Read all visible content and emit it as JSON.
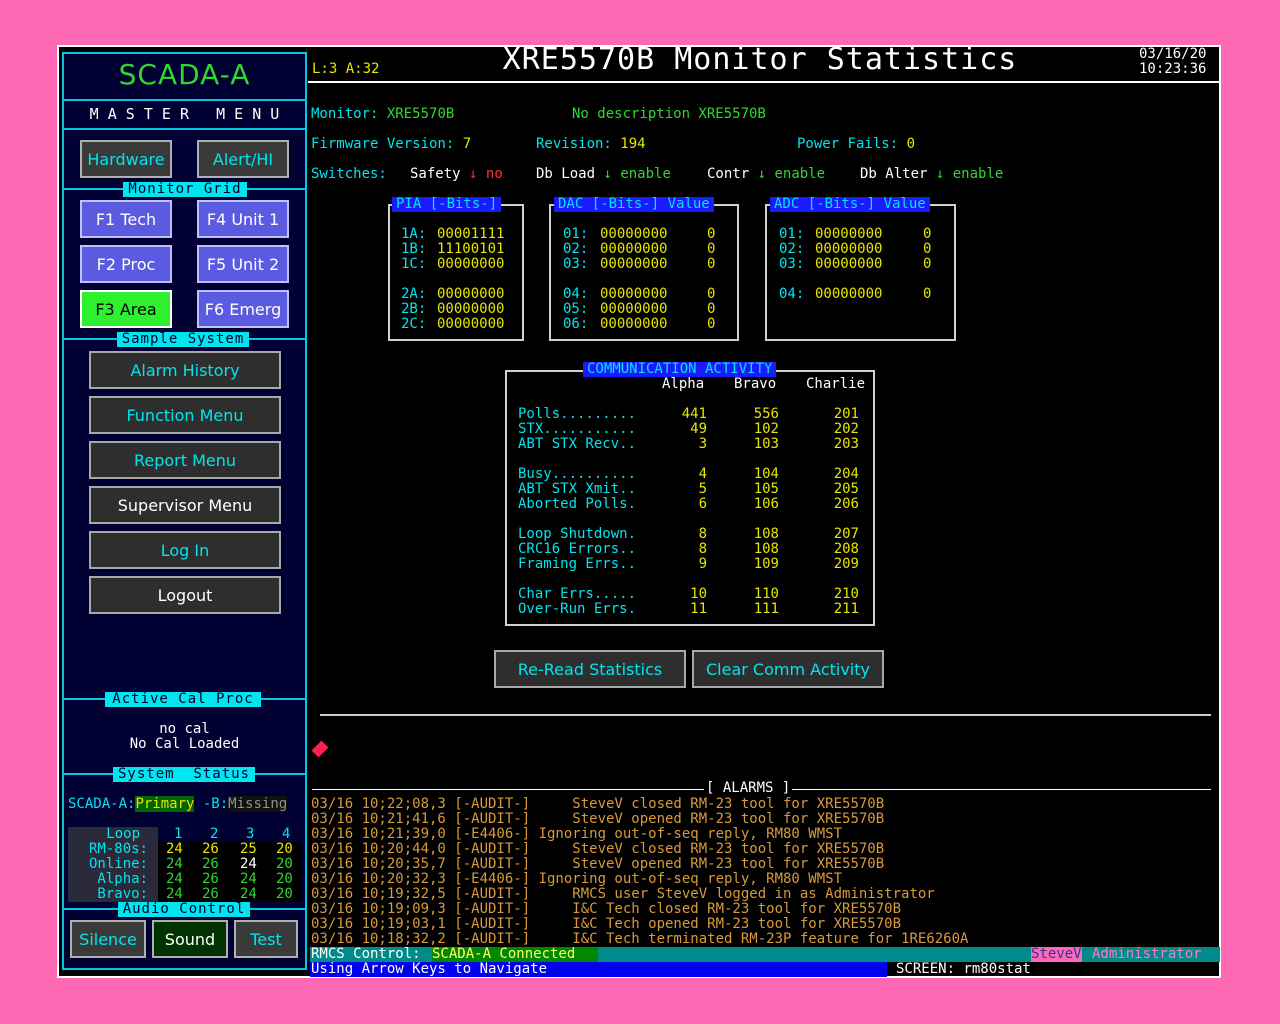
{
  "sidebar": {
    "title": "SCADA-A",
    "master_menu": "M A S T E R   M E N U",
    "hardware_btn": "Hardware",
    "alert_btn": "Alert/HI",
    "monitor_grid_title": "Monitor Grid",
    "grid_buttons": [
      "F1 Tech",
      "F4 Unit 1",
      "F2 Proc",
      "F5 Unit 2",
      "F3 Area",
      "F6 Emerg"
    ],
    "sample_system_title": "Sample System",
    "menu_buttons": [
      "Alarm History",
      "Function Menu",
      "Report Menu",
      "Supervisor Menu",
      "Log In",
      "Logout"
    ],
    "active_cal_title": "Active Cal Proc",
    "cal_line1": "no cal",
    "cal_line2": "No Cal Loaded",
    "system_status_title": "System  Status",
    "status_a_label": "SCADA-A:",
    "status_a_value": "Primary",
    "status_b_label": " -B:",
    "status_b_value": "Missing",
    "loop_table": {
      "header": [
        "Loop",
        "1",
        "2",
        "3",
        "4"
      ],
      "rows": [
        {
          "label": "RM-80s:",
          "values": [
            "24",
            "26",
            "25",
            "20"
          ]
        },
        {
          "label": "Online:",
          "values": [
            "24",
            "26",
            "24",
            "20"
          ]
        },
        {
          "label": "Alpha:",
          "values": [
            "24",
            "26",
            "24",
            "20"
          ]
        },
        {
          "label": "Bravo:",
          "values": [
            "24",
            "26",
            "24",
            "20"
          ]
        }
      ]
    },
    "audio_title": "Audio Control",
    "audio_buttons": [
      "Silence",
      "Sound",
      "Test"
    ]
  },
  "header": {
    "la": "L:3 A:32",
    "title": "XRE5570B Monitor Statistics",
    "date": "03/16/20",
    "time": "10:23:36"
  },
  "monitor": {
    "monitor_label": "Monitor:",
    "monitor_value": "XRE5570B",
    "description": "No description XRE5570B",
    "fw_label": "Firmware Version:",
    "fw_value": "7",
    "rev_label": "Revision:",
    "rev_value": "194",
    "pf_label": "Power Fails:",
    "pf_value": "0",
    "switches_label": "Switches:",
    "switches": [
      {
        "name": "Safety",
        "value": "no"
      },
      {
        "name": "Db Load",
        "value": "enable"
      },
      {
        "name": "Contr",
        "value": "enable"
      },
      {
        "name": "Db Alter",
        "value": "enable"
      }
    ]
  },
  "pia": {
    "title": "PIA [-Bits-]",
    "group1": [
      [
        "1A:",
        "00001111"
      ],
      [
        "1B:",
        "11100101"
      ],
      [
        "1C:",
        "00000000"
      ]
    ],
    "group2": [
      [
        "2A:",
        "00000000"
      ],
      [
        "2B:",
        "00000000"
      ],
      [
        "2C:",
        "00000000"
      ]
    ]
  },
  "dac": {
    "title": "DAC [-Bits-] Value",
    "group1": [
      [
        "01:",
        "00000000",
        "0"
      ],
      [
        "02:",
        "00000000",
        "0"
      ],
      [
        "03:",
        "00000000",
        "0"
      ]
    ],
    "group2": [
      [
        "04:",
        "00000000",
        "0"
      ],
      [
        "05:",
        "00000000",
        "0"
      ],
      [
        "06:",
        "00000000",
        "0"
      ]
    ]
  },
  "adc": {
    "title": "ADC [-Bits-] Value",
    "group1": [
      [
        "01:",
        "00000000",
        "0"
      ],
      [
        "02:",
        "00000000",
        "0"
      ],
      [
        "03:",
        "00000000",
        "0"
      ]
    ],
    "group2": [
      [
        "04:",
        "00000000",
        "0"
      ]
    ]
  },
  "comm": {
    "title": "COMMUNICATION ACTIVITY",
    "columns": [
      "Alpha",
      "Bravo",
      "Charlie"
    ],
    "groups": [
      [
        [
          "Polls.........",
          "441",
          "556",
          "201"
        ],
        [
          "STX...........",
          "49",
          "102",
          "202"
        ],
        [
          "ABT STX Recv..",
          "3",
          "103",
          "203"
        ]
      ],
      [
        [
          "Busy..........",
          "4",
          "104",
          "204"
        ],
        [
          "ABT STX Xmit..",
          "5",
          "105",
          "205"
        ],
        [
          "Aborted Polls.",
          "6",
          "106",
          "206"
        ]
      ],
      [
        [
          "Loop Shutdown.",
          "8",
          "108",
          "207"
        ],
        [
          "CRC16 Errors..",
          "8",
          "108",
          "208"
        ],
        [
          "Framing Errs..",
          "9",
          "109",
          "209"
        ]
      ],
      [
        [
          "Char Errs.....",
          "10",
          "110",
          "210"
        ],
        [
          "Over-Run Errs.",
          "11",
          "111",
          "211"
        ]
      ]
    ]
  },
  "actions": {
    "reread": "Re-Read Statistics",
    "clear": "Clear Comm Activity"
  },
  "alarms": {
    "title": "[ ALARMS ]",
    "entries": [
      {
        "text": "03/16 10;22;08,3 [-AUDIT-]     SteveV closed RM-23 tool for XRE5570B"
      },
      {
        "text": "03/16 10;21;41,6 [-AUDIT-]     SteveV opened RM-23 tool for XRE5570B"
      },
      {
        "text": "03/16 10;21;39,0 [-E4406-] Ignoring out-of-seq reply, RM80 WMST"
      },
      {
        "text": "03/16 10;20;44,0 [-AUDIT-]     SteveV closed RM-23 tool for XRE5570B"
      },
      {
        "text": "03/16 10;20;35,7 [-AUDIT-]     SteveV opened RM-23 tool for XRE5570B"
      },
      {
        "text": "03/16 10;20;32,3 [-E4406-] Ignoring out-of-seq reply, RM80 WMST"
      },
      {
        "text": "03/16 10;19;32,5 [-AUDIT-]     RMCS user SteveV logged in as Administrator"
      },
      {
        "text": "03/16 10;19;09,3 [-AUDIT-]     I&C Tech closed RM-23 tool for XRE5570B"
      },
      {
        "text": "03/16 10;19;03,1 [-AUDIT-]     I&C Tech opened RM-23 tool for XRE5570B"
      },
      {
        "text": "03/16 10;18;32,2 [-AUDIT-]     I&C Tech terminated RM-23P feature for 1RE6260A"
      }
    ]
  },
  "statusbar": {
    "control_label": "RMCS Control:",
    "control_value": "SCADA-A Connected",
    "user": "SteveV",
    "role": "Administrator",
    "hint": "Using Arrow Keys to Navigate",
    "screen": "SCREEN: rm80stat"
  },
  "colors": {
    "background": "#ff69b4",
    "panel": "#000033",
    "accent": "#00e5ee",
    "value": "#e6e600",
    "ok": "#2fd82f",
    "alarm_text": "#d89a3a"
  }
}
